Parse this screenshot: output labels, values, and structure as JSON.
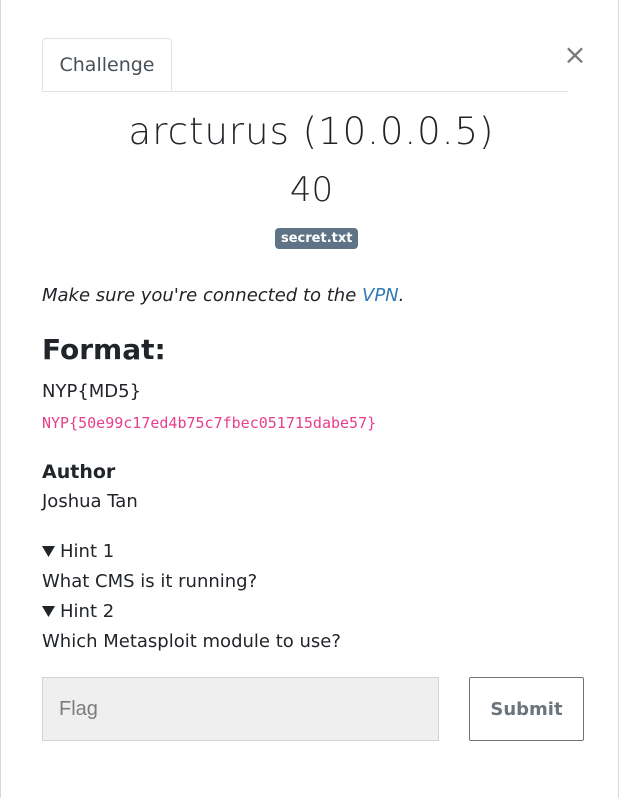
{
  "tabs": {
    "active_label": "Challenge"
  },
  "close": {
    "symbol": "×"
  },
  "challenge": {
    "name": "arcturus (10.0.0.5)",
    "points": "40",
    "file_badge": "secret.txt"
  },
  "description": {
    "prefix": "Make sure you're connected to the ",
    "link_text": "VPN",
    "suffix": "."
  },
  "format": {
    "heading": "Format:",
    "pattern": "NYP{MD5}",
    "example": "NYP{50e99c17ed4b75c7fbec051715dabe57}"
  },
  "author": {
    "label": "Author",
    "name": "Joshua Tan"
  },
  "hints": [
    {
      "summary": "Hint 1",
      "body": "What CMS is it running?"
    },
    {
      "summary": "Hint 2",
      "body": "Which Metasploit module to use?"
    }
  ],
  "submission": {
    "placeholder": "Flag",
    "value": "",
    "submit_label": "Submit"
  },
  "colors": {
    "badge": "#5e7385",
    "link": "#337ab7",
    "code": "#e83e8c"
  },
  "icons": {
    "hint_toggle": "triangle-down-icon",
    "close": "close-icon"
  }
}
